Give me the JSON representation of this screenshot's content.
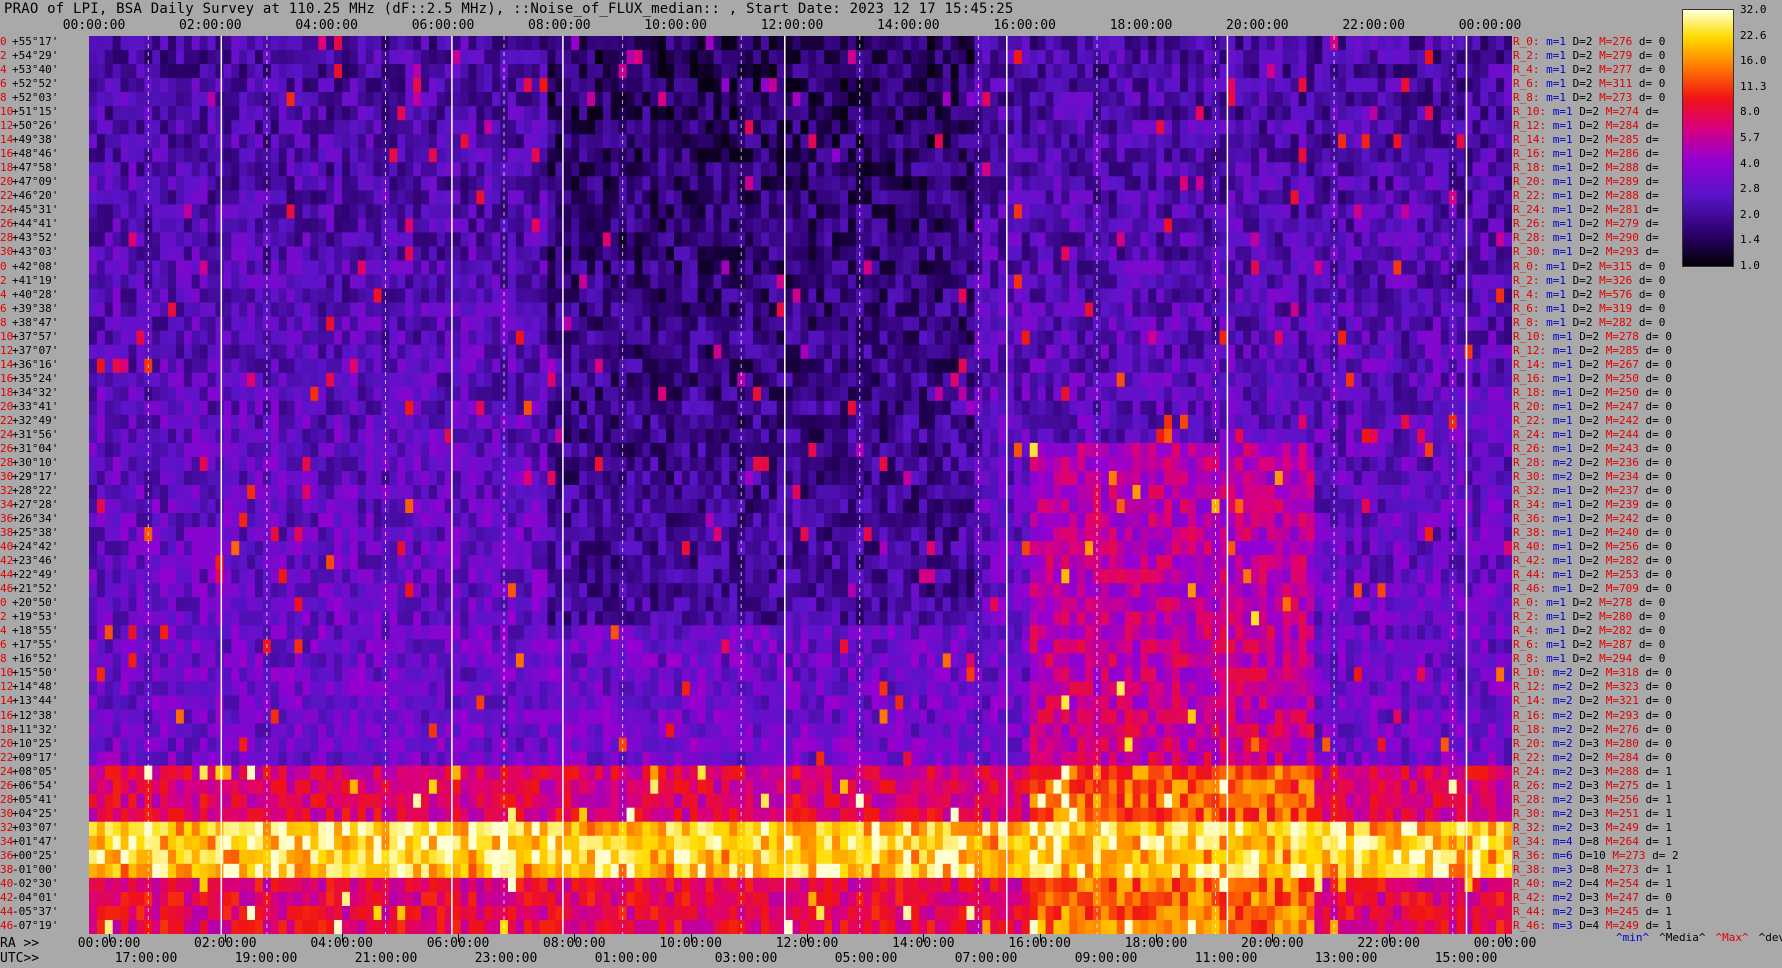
{
  "title": "PRAO of LPI, BSA Daily Survey at 110.25 MHz (dF::2.5 MHz), ::Noise_of_FLUX_median:: , Start Date: 2023 12 17 15:45:25",
  "chart_data": {
    "type": "heatmap",
    "title": "PRAO of LPI, BSA Daily Survey at 110.25 MHz (dF::2.5 MHz), ::Noise_of_FLUX_median:: , Start Date: 2023 12 17 15:45:25",
    "x_top_ticks": [
      "00:00:00",
      "02:00:00",
      "04:00:00",
      "06:00:00",
      "08:00:00",
      "10:00:00",
      "12:00:00",
      "14:00:00",
      "16:00:00",
      "18:00:00",
      "20:00:00",
      "22:00:00",
      "00:00:00"
    ],
    "x_bottom_ra_label": "RA >>",
    "x_bottom_ra_ticks": [
      "00:00:00",
      "02:00:00",
      "04:00:00",
      "06:00:00",
      "08:00:00",
      "10:00:00",
      "12:00:00",
      "14:00:00",
      "16:00:00",
      "18:00:00",
      "20:00:00",
      "22:00:00",
      "00:00:00"
    ],
    "x_bottom_utc_label": "UTC>>",
    "x_bottom_utc_ticks": [
      "17:00:00",
      "19:00:00",
      "21:00:00",
      "23:00:00",
      "01:00:00",
      "03:00:00",
      "05:00:00",
      "07:00:00",
      "09:00:00",
      "11:00:00",
      "13:00:00",
      "15:00:00"
    ],
    "colorbar_ticks": [
      "32.0",
      "22.6",
      "16.0",
      "11.3",
      "8.0",
      "5.7",
      "4.0",
      "2.8",
      "2.0",
      "1.4",
      "1.0"
    ],
    "colorbar_range": [
      1.0,
      32.0
    ],
    "colorbar_scale": "log",
    "declinations": [
      "+55°17'",
      "+54°29'",
      "+53°40'",
      "+52°52'",
      "+52°03'",
      "+51°15'",
      "+50°26'",
      "+49°38'",
      "+48°46'",
      "+47°58'",
      "+47°09'",
      "+46°20'",
      "+45°31'",
      "+44°41'",
      "+43°52'",
      "+43°03'",
      "+42°08'",
      "+41°19'",
      "+40°28'",
      "+39°38'",
      "+38°47'",
      "+37°57'",
      "+37°07'",
      "+36°16'",
      "+35°24'",
      "+34°32'",
      "+33°41'",
      "+32°49'",
      "+31°56'",
      "+31°04'",
      "+30°10'",
      "+29°17'",
      "+28°22'",
      "+27°28'",
      "+26°34'",
      "+25°38'",
      "+24°42'",
      "+23°46'",
      "+22°49'",
      "+21°52'",
      "+20°50'",
      "+19°53'",
      "+18°55'",
      "+17°55'",
      "+16°52'",
      "+15°50'",
      "+14°48'",
      "+13°44'",
      "+12°38'",
      "+11°32'",
      "+10°25'",
      "+09°17'",
      "+08°05'",
      "+06°54'",
      "+05°41'",
      "+04°25'",
      "+03°07'",
      "+01°47'",
      "+00°25'",
      "-01°00'",
      "-02°30'",
      "-04°01'",
      "-05°37'",
      "-07°19'"
    ],
    "stats": [
      {
        "r": "R_0:",
        "m": "m=1",
        "D": "D=2",
        "M": "M=276",
        "d": "d= 0"
      },
      {
        "r": "R_2:",
        "m": "m=1",
        "D": "D=2",
        "M": "M=279",
        "d": "d= 0"
      },
      {
        "r": "R_4:",
        "m": "m=1",
        "D": "D=2",
        "M": "M=277",
        "d": "d= 0"
      },
      {
        "r": "R_6:",
        "m": "m=1",
        "D": "D=2",
        "M": "M=311",
        "d": "d= 0"
      },
      {
        "r": "R_8:",
        "m": "m=1",
        "D": "D=2",
        "M": "M=273",
        "d": "d= 0"
      },
      {
        "r": "R_10:",
        "m": "m=1",
        "D": "D=2",
        "M": "M=274",
        "d": "d="
      },
      {
        "r": "R_12:",
        "m": "m=1",
        "D": "D=2",
        "M": "M=284",
        "d": "d="
      },
      {
        "r": "R_14:",
        "m": "m=1",
        "D": "D=2",
        "M": "M=285",
        "d": "d="
      },
      {
        "r": "R_16:",
        "m": "m=1",
        "D": "D=2",
        "M": "M=286",
        "d": "d="
      },
      {
        "r": "R_18:",
        "m": "m=1",
        "D": "D=2",
        "M": "M=288",
        "d": "d="
      },
      {
        "r": "R_20:",
        "m": "m=1",
        "D": "D=2",
        "M": "M=289",
        "d": "d="
      },
      {
        "r": "R_22:",
        "m": "m=1",
        "D": "D=2",
        "M": "M=288",
        "d": "d="
      },
      {
        "r": "R_24:",
        "m": "m=1",
        "D": "D=2",
        "M": "M=281",
        "d": "d="
      },
      {
        "r": "R_26:",
        "m": "m=1",
        "D": "D=2",
        "M": "M=279",
        "d": "d="
      },
      {
        "r": "R_28:",
        "m": "m=1",
        "D": "D=2",
        "M": "M=290",
        "d": "d="
      },
      {
        "r": "R_30:",
        "m": "m=1",
        "D": "D=2",
        "M": "M=293",
        "d": "d="
      },
      {
        "r": "R_0:",
        "m": "m=1",
        "D": "D=2",
        "M": "M=315",
        "d": "d= 0"
      },
      {
        "r": "R_2:",
        "m": "m=1",
        "D": "D=2",
        "M": "M=326",
        "d": "d= 0"
      },
      {
        "r": "R_4:",
        "m": "m=1",
        "D": "D=2",
        "M": "M=576",
        "d": "d= 0"
      },
      {
        "r": "R_6:",
        "m": "m=1",
        "D": "D=2",
        "M": "M=319",
        "d": "d= 0"
      },
      {
        "r": "R_8:",
        "m": "m=1",
        "D": "D=2",
        "M": "M=282",
        "d": "d= 0"
      },
      {
        "r": "R_10:",
        "m": "m=1",
        "D": "D=2",
        "M": "M=278",
        "d": "d= 0"
      },
      {
        "r": "R_12:",
        "m": "m=1",
        "D": "D=2",
        "M": "M=285",
        "d": "d= 0"
      },
      {
        "r": "R_14:",
        "m": "m=1",
        "D": "D=2",
        "M": "M=267",
        "d": "d= 0"
      },
      {
        "r": "R_16:",
        "m": "m=1",
        "D": "D=2",
        "M": "M=250",
        "d": "d= 0"
      },
      {
        "r": "R_18:",
        "m": "m=1",
        "D": "D=2",
        "M": "M=250",
        "d": "d= 0"
      },
      {
        "r": "R_20:",
        "m": "m=1",
        "D": "D=2",
        "M": "M=247",
        "d": "d= 0"
      },
      {
        "r": "R_22:",
        "m": "m=1",
        "D": "D=2",
        "M": "M=242",
        "d": "d= 0"
      },
      {
        "r": "R_24:",
        "m": "m=1",
        "D": "D=2",
        "M": "M=244",
        "d": "d= 0"
      },
      {
        "r": "R_26:",
        "m": "m=1",
        "D": "D=2",
        "M": "M=243",
        "d": "d= 0"
      },
      {
        "r": "R_28:",
        "m": "m=2",
        "D": "D=2",
        "M": "M=236",
        "d": "d= 0"
      },
      {
        "r": "R_30:",
        "m": "m=2",
        "D": "D=2",
        "M": "M=234",
        "d": "d= 0"
      },
      {
        "r": "R_32:",
        "m": "m=1",
        "D": "D=2",
        "M": "M=237",
        "d": "d= 0"
      },
      {
        "r": "R_34:",
        "m": "m=1",
        "D": "D=2",
        "M": "M=239",
        "d": "d= 0"
      },
      {
        "r": "R_36:",
        "m": "m=1",
        "D": "D=2",
        "M": "M=242",
        "d": "d= 0"
      },
      {
        "r": "R_38:",
        "m": "m=1",
        "D": "D=2",
        "M": "M=240",
        "d": "d= 0"
      },
      {
        "r": "R_40:",
        "m": "m=1",
        "D": "D=2",
        "M": "M=256",
        "d": "d= 0"
      },
      {
        "r": "R_42:",
        "m": "m=1",
        "D": "D=2",
        "M": "M=282",
        "d": "d= 0"
      },
      {
        "r": "R_44:",
        "m": "m=1",
        "D": "D=2",
        "M": "M=253",
        "d": "d= 0"
      },
      {
        "r": "R_46:",
        "m": "m=1",
        "D": "D=2",
        "M": "M=709",
        "d": "d= 0"
      },
      {
        "r": "R_0:",
        "m": "m=1",
        "D": "D=2",
        "M": "M=278",
        "d": "d= 0"
      },
      {
        "r": "R_2:",
        "m": "m=1",
        "D": "D=2",
        "M": "M=280",
        "d": "d= 0"
      },
      {
        "r": "R_4:",
        "m": "m=1",
        "D": "D=2",
        "M": "M=282",
        "d": "d= 0"
      },
      {
        "r": "R_6:",
        "m": "m=1",
        "D": "D=2",
        "M": "M=287",
        "d": "d= 0"
      },
      {
        "r": "R_8:",
        "m": "m=1",
        "D": "D=2",
        "M": "M=294",
        "d": "d= 0"
      },
      {
        "r": "R_10:",
        "m": "m=2",
        "D": "D=2",
        "M": "M=318",
        "d": "d= 0"
      },
      {
        "r": "R_12:",
        "m": "m=2",
        "D": "D=2",
        "M": "M=323",
        "d": "d= 0"
      },
      {
        "r": "R_14:",
        "m": "m=2",
        "D": "D=2",
        "M": "M=321",
        "d": "d= 0"
      },
      {
        "r": "R_16:",
        "m": "m=2",
        "D": "D=2",
        "M": "M=293",
        "d": "d= 0"
      },
      {
        "r": "R_18:",
        "m": "m=2",
        "D": "D=2",
        "M": "M=276",
        "d": "d= 0"
      },
      {
        "r": "R_20:",
        "m": "m=2",
        "D": "D=3",
        "M": "M=280",
        "d": "d= 0"
      },
      {
        "r": "R_22:",
        "m": "m=2",
        "D": "D=2",
        "M": "M=284",
        "d": "d= 0"
      },
      {
        "r": "R_24:",
        "m": "m=2",
        "D": "D=3",
        "M": "M=288",
        "d": "d= 1"
      },
      {
        "r": "R_26:",
        "m": "m=2",
        "D": "D=3",
        "M": "M=275",
        "d": "d= 1"
      },
      {
        "r": "R_28:",
        "m": "m=2",
        "D": "D=3",
        "M": "M=256",
        "d": "d= 1"
      },
      {
        "r": "R_30:",
        "m": "m=2",
        "D": "D=3",
        "M": "M=251",
        "d": "d= 1"
      },
      {
        "r": "R_32:",
        "m": "m=2",
        "D": "D=3",
        "M": "M=249",
        "d": "d= 1"
      },
      {
        "r": "R_34:",
        "m": "m=4",
        "D": "D=8",
        "M": "M=264",
        "d": "d= 1"
      },
      {
        "r": "R_36:",
        "m": "m=6",
        "D": "D=10",
        "M": "M=273",
        "d": "d= 2"
      },
      {
        "r": "R_38:",
        "m": "m=3",
        "D": "D=8",
        "M": "M=273",
        "d": "d= 1"
      },
      {
        "r": "R_40:",
        "m": "m=2",
        "D": "D=4",
        "M": "M=254",
        "d": "d= 1"
      },
      {
        "r": "R_42:",
        "m": "m=2",
        "D": "D=3",
        "M": "M=247",
        "d": "d= 0"
      },
      {
        "r": "R_44:",
        "m": "m=2",
        "D": "D=3",
        "M": "M=245",
        "d": "d= 1"
      },
      {
        "r": "R_46:",
        "m": "m=3",
        "D": "D=4",
        "M": "M=249",
        "d": "d= 1"
      }
    ],
    "row_indices": [
      "0",
      "2",
      "4",
      "6",
      "8",
      "10",
      "12",
      "14",
      "16",
      "18",
      "20",
      "22",
      "24",
      "26",
      "28",
      "30",
      "0",
      "2",
      "4",
      "6",
      "8",
      "10",
      "12",
      "14",
      "16",
      "18",
      "20",
      "22",
      "24",
      "26",
      "28",
      "30",
      "32",
      "34",
      "36",
      "38",
      "40",
      "42",
      "44",
      "46",
      "0",
      "2",
      "4",
      "6",
      "8",
      "10",
      "12",
      "14",
      "16",
      "18",
      "20",
      "22",
      "24",
      "26",
      "28",
      "30",
      "32",
      "34",
      "36",
      "38",
      "40",
      "42",
      "44",
      "46"
    ],
    "legend": {
      "min": "^min^",
      "median": "^Media^",
      "max": "^Max^",
      "devia": "^devia^"
    }
  },
  "colors": {
    "index_red": "#e00000",
    "m_blue": "#0000c8",
    "max_red": "#e00000",
    "background": "#a9a9a9"
  }
}
